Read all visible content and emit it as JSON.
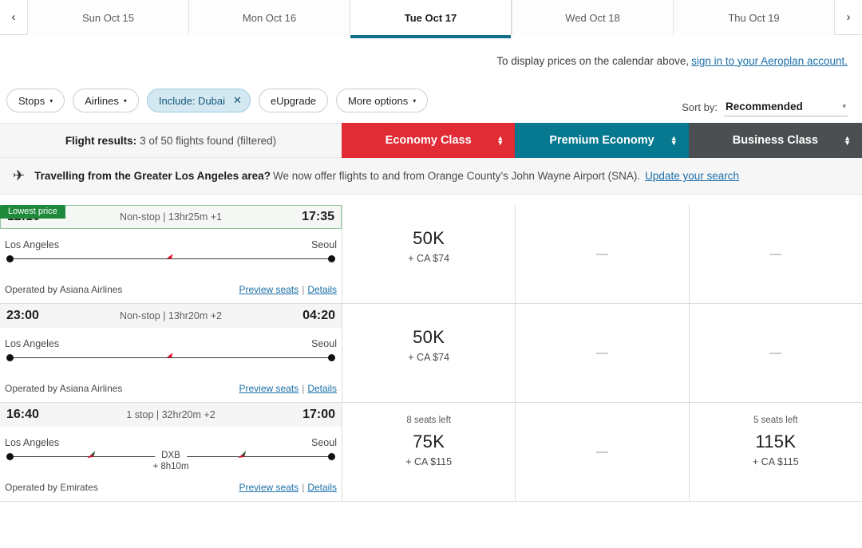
{
  "date_strip": {
    "prev_icon": "chevron-left-icon",
    "next_icon": "chevron-right-icon",
    "prev_label": "‹",
    "next_label": "›",
    "tabs": [
      {
        "label": "Sun Oct 15",
        "active": false
      },
      {
        "label": "Mon Oct 16",
        "active": false
      },
      {
        "label": "Tue Oct 17",
        "active": true
      },
      {
        "label": "Wed Oct 18",
        "active": false
      },
      {
        "label": "Thu Oct 19",
        "active": false
      }
    ]
  },
  "signin_notice": {
    "text": "To display prices on the calendar above,",
    "link": "sign in to your Aeroplan account."
  },
  "filters": {
    "chips": [
      {
        "label": "Stops",
        "caret": "▾",
        "active": false
      },
      {
        "label": "Airlines",
        "caret": "▾",
        "active": false
      },
      {
        "label": "Include: Dubai",
        "close": "✕",
        "active": true
      },
      {
        "label": "eUpgrade",
        "active": false
      },
      {
        "label": "More options",
        "caret": "▾",
        "active": false
      }
    ],
    "sort_label": "Sort by:",
    "sort_value": "Recommended",
    "sort_caret": "▾"
  },
  "results_header": {
    "title": "Flight results:",
    "count_text": "3 of 50 flights found (filtered)",
    "classes": [
      {
        "label": "Economy Class",
        "color": "#e12b35"
      },
      {
        "label": "Premium Economy",
        "color": "#06788f"
      },
      {
        "label": "Business Class",
        "color": "#4b4f51"
      }
    ],
    "sort_up": "▲",
    "sort_down": "▼"
  },
  "info_banner": {
    "icon": "airplane-icon",
    "bold": "Travelling from the Greater Los Angeles area?",
    "text": "We now offer flights to and from Orange County’s John Wayne Airport (SNA).",
    "link": "Update your search"
  },
  "lowest_price_badge": "Lowest price",
  "flights": [
    {
      "depart_time": "12:10",
      "middle": "Non-stop | 13hr25m +1",
      "arrive_time": "17:35",
      "origin": "Los Angeles",
      "destination": "Seoul",
      "stop_code": "",
      "stop_duration": "",
      "operated_by": "Operated by Asiana Airlines",
      "carrier": "asiana",
      "preview_seats": "Preview seats",
      "separator": "|",
      "details": "Details",
      "fares": [
        {
          "seats_left": "",
          "points": "50K",
          "cash": "+ CA $74",
          "empty": false
        },
        {
          "seats_left": "",
          "points": "—",
          "cash": "",
          "empty": true
        },
        {
          "seats_left": "",
          "points": "—",
          "cash": "",
          "empty": true
        }
      ],
      "lowest": true
    },
    {
      "depart_time": "23:00",
      "middle": "Non-stop | 13hr20m +2",
      "arrive_time": "04:20",
      "origin": "Los Angeles",
      "destination": "Seoul",
      "stop_code": "",
      "stop_duration": "",
      "operated_by": "Operated by Asiana Airlines",
      "carrier": "asiana",
      "preview_seats": "Preview seats",
      "separator": "|",
      "details": "Details",
      "fares": [
        {
          "seats_left": "",
          "points": "50K",
          "cash": "+ CA $74",
          "empty": false
        },
        {
          "seats_left": "",
          "points": "—",
          "cash": "",
          "empty": true
        },
        {
          "seats_left": "",
          "points": "—",
          "cash": "",
          "empty": true
        }
      ],
      "lowest": false
    },
    {
      "depart_time": "16:40",
      "middle": "1 stop | 32hr20m +2",
      "arrive_time": "17:00",
      "origin": "Los Angeles",
      "destination": "Seoul",
      "stop_code": "DXB",
      "stop_duration": "+ 8h10m",
      "operated_by": "Operated by Emirates",
      "carrier": "emirates",
      "preview_seats": "Preview seats",
      "separator": "|",
      "details": "Details",
      "fares": [
        {
          "seats_left": "8 seats left",
          "points": "75K",
          "cash": "+ CA $115",
          "empty": false
        },
        {
          "seats_left": "",
          "points": "—",
          "cash": "",
          "empty": true
        },
        {
          "seats_left": "5 seats left",
          "points": "115K",
          "cash": "+ CA $115",
          "empty": false
        }
      ],
      "lowest": false
    }
  ]
}
